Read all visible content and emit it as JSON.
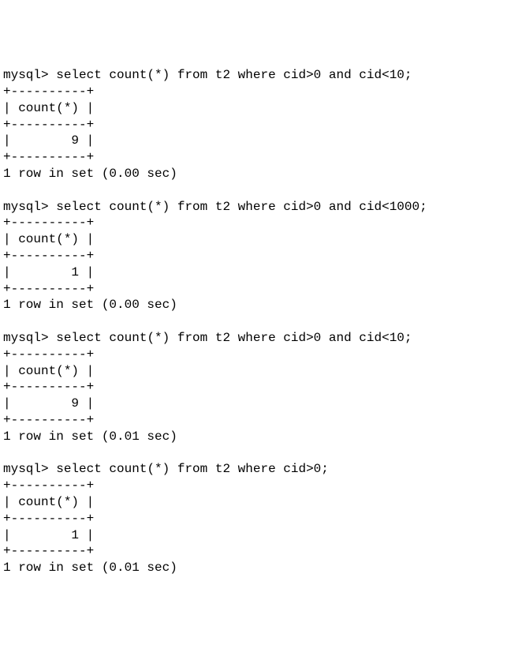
{
  "queries": [
    {
      "prompt": "mysql>",
      "sql": "select count(*) from t2 where cid>0 and cid<10;",
      "border": "+----------+",
      "header": "| count(*) |",
      "value_line": "|        9 |",
      "footer": "1 row in set (0.00 sec)"
    },
    {
      "prompt": "mysql>",
      "sql": "select count(*) from t2 where cid>0 and cid<1000;",
      "border": "+----------+",
      "header": "| count(*) |",
      "value_line": "|        1 |",
      "footer": "1 row in set (0.00 sec)"
    },
    {
      "prompt": "mysql>",
      "sql": "select count(*) from t2 where cid>0 and cid<10;",
      "border": "+----------+",
      "header": "| count(*) |",
      "value_line": "|        9 |",
      "footer": "1 row in set (0.01 sec)"
    },
    {
      "prompt": "mysql>",
      "sql": "select count(*) from t2 where cid>0;",
      "border": "+----------+",
      "header": "| count(*) |",
      "value_line": "|        1 |",
      "footer": "1 row in set (0.01 sec)"
    }
  ]
}
